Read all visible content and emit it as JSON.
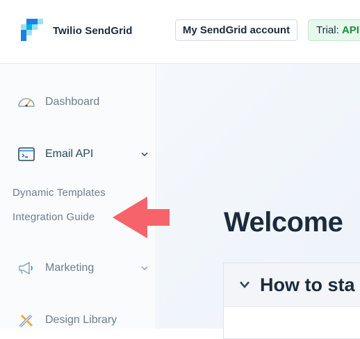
{
  "header": {
    "brand": "Twilio SendGrid",
    "account_button": "My SendGrid account",
    "trial_prefix": "Trial:",
    "trial_value": "API"
  },
  "sidebar": {
    "items": [
      {
        "label": "Dashboard",
        "icon": "gauge-icon"
      },
      {
        "label": "Email API",
        "icon": "terminal-icon",
        "expanded": true
      },
      {
        "label": "Marketing",
        "icon": "megaphone-icon"
      },
      {
        "label": "Design Library",
        "icon": "pencil-ruler-icon"
      }
    ],
    "email_api_subitems": [
      "Dynamic Templates",
      "Integration Guide"
    ]
  },
  "main": {
    "welcome": "Welcome",
    "card_title": "How to sta"
  },
  "colors": {
    "brand_blue": "#1a82e2",
    "arrow_red": "#f7636b",
    "trial_green": "#1c8c3c"
  }
}
